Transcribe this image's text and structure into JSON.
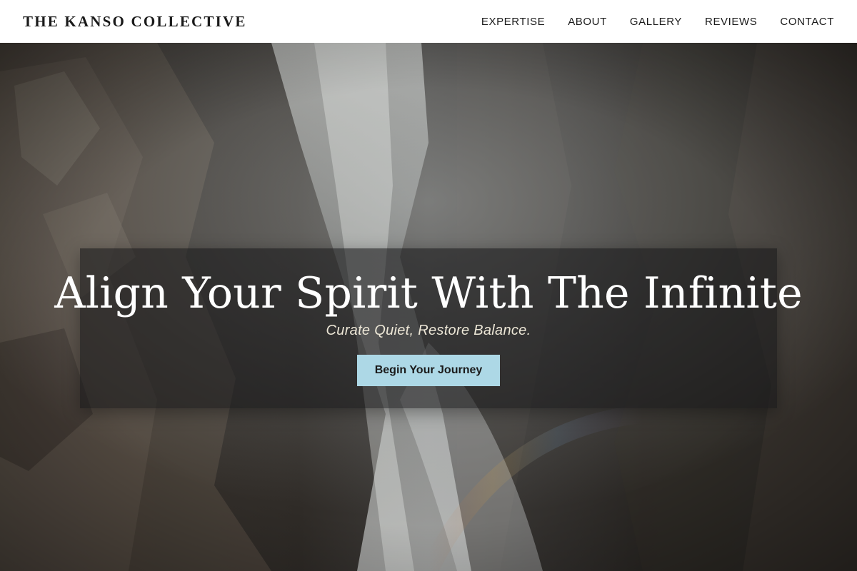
{
  "header": {
    "brand": "THE KANSO COLLECTIVE",
    "nav": [
      {
        "label": "EXPERTISE"
      },
      {
        "label": "ABOUT"
      },
      {
        "label": "GALLERY"
      },
      {
        "label": "REVIEWS"
      },
      {
        "label": "CONTACT"
      }
    ]
  },
  "hero": {
    "title": "Align Your Spirit With The Infinite",
    "subtitle": "Curate Quiet, Restore Balance.",
    "cta_label": "Begin Your Journey",
    "background_image": "waterfall-canyon"
  },
  "colors": {
    "header_bg": "#ffffff",
    "text_dark": "#1a1a1a",
    "cta_bg": "#add8e6",
    "panel_overlay": "rgba(22,22,24,0.58)"
  }
}
